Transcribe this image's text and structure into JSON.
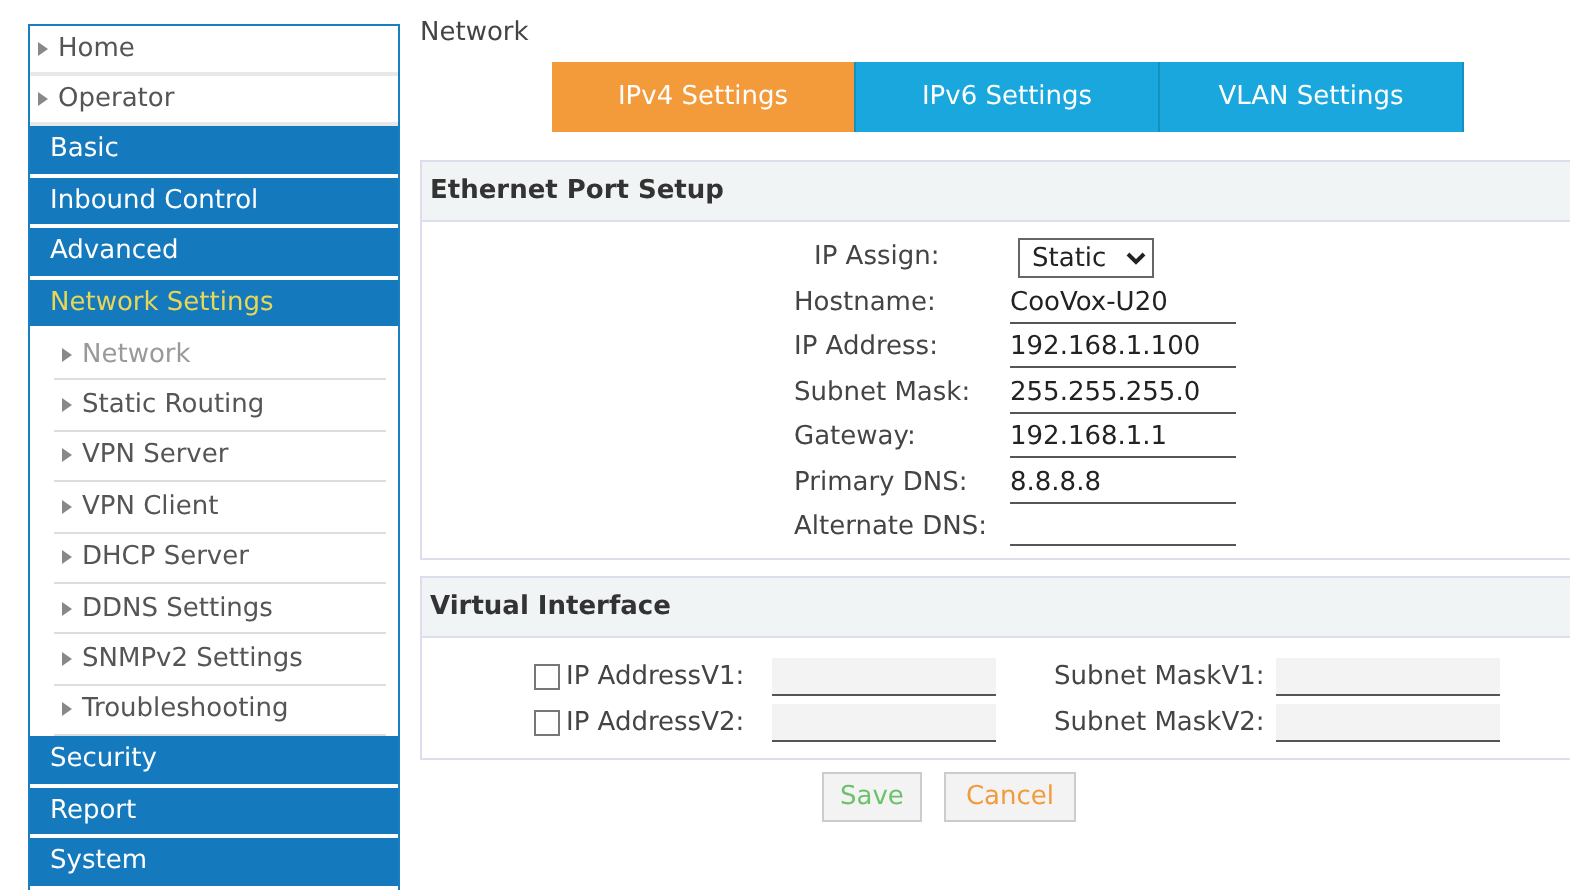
{
  "sidebar": {
    "items": [
      {
        "label": "Home",
        "kind": "link",
        "selected": false
      },
      {
        "label": "Operator",
        "kind": "link",
        "selected": false
      },
      {
        "label": "Basic",
        "kind": "section",
        "selected": false
      },
      {
        "label": "Inbound Control",
        "kind": "section",
        "selected": false
      },
      {
        "label": "Advanced",
        "kind": "section",
        "selected": false
      },
      {
        "label": "Network Settings",
        "kind": "section",
        "selected": true
      },
      {
        "label": "Network",
        "kind": "sub",
        "selected": true
      },
      {
        "label": "Static Routing",
        "kind": "sub",
        "selected": false
      },
      {
        "label": "VPN Server",
        "kind": "sub",
        "selected": false
      },
      {
        "label": "VPN Client",
        "kind": "sub",
        "selected": false
      },
      {
        "label": "DHCP Server",
        "kind": "sub",
        "selected": false
      },
      {
        "label": "DDNS Settings",
        "kind": "sub",
        "selected": false
      },
      {
        "label": "SNMPv2 Settings",
        "kind": "sub",
        "selected": false
      },
      {
        "label": "Troubleshooting",
        "kind": "sub",
        "selected": false
      },
      {
        "label": "Security",
        "kind": "section",
        "selected": false
      },
      {
        "label": "Report",
        "kind": "section",
        "selected": false
      },
      {
        "label": "System",
        "kind": "section",
        "selected": false
      }
    ]
  },
  "page_title": "Network",
  "tabs": [
    {
      "label": "IPv4 Settings",
      "selected": true
    },
    {
      "label": "IPv6 Settings",
      "selected": false
    },
    {
      "label": "VLAN Settings",
      "selected": false
    }
  ],
  "ethernet": {
    "title": "Ethernet Port Setup",
    "ip_assign": {
      "label": "IP Assign:",
      "value": "Static"
    },
    "fields": [
      {
        "label": "Hostname:",
        "value": "CooVox-U20"
      },
      {
        "label": "IP Address:",
        "value": "192.168.1.100"
      },
      {
        "label": "Subnet Mask:",
        "value": "255.255.255.0"
      },
      {
        "label": "Gateway:",
        "value": "192.168.1.1"
      },
      {
        "label": "Primary DNS:",
        "value": "8.8.8.8"
      },
      {
        "label": "Alternate DNS:"
      }
    ]
  },
  "virtual": {
    "title": "Virtual Interface",
    "rows": [
      {
        "checked": false,
        "ip_label": "IP AddressV1:",
        "mask_label": "Subnet MaskV1:"
      },
      {
        "checked": false,
        "ip_label": "IP AddressV2:",
        "mask_label": "Subnet MaskV2:"
      }
    ]
  },
  "buttons": {
    "save": "Save",
    "cancel": "Cancel"
  }
}
